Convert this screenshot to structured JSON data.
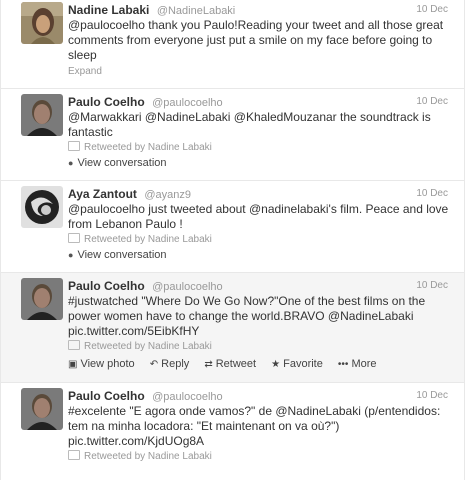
{
  "tweets": [
    {
      "name": "Nadine Labaki",
      "handle": "@NadineLabaki",
      "date": "10 Dec",
      "text": "@paulocoelho thank you Paulo!Reading your tweet and all those great comments from everyone just put a smile on my face before going to sleep",
      "expand": "Expand"
    },
    {
      "name": "Paulo Coelho",
      "handle": "@paulocoelho",
      "date": "10 Dec",
      "text": "@Marwakkari @NadineLabaki @KhaledMouzanar the soundtrack is fantastic",
      "retweeted": "Retweeted by Nadine Labaki",
      "view_conversation": "View conversation"
    },
    {
      "name": "Aya Zantout",
      "handle": "@ayanz9",
      "date": "10 Dec",
      "text": "@paulocoelho just tweeted about @nadinelabaki's film. Peace and love from Lebanon Paulo !",
      "retweeted": "Retweeted by Nadine Labaki",
      "view_conversation": "View conversation"
    },
    {
      "name": "Paulo Coelho",
      "handle": "@paulocoelho",
      "date": "10 Dec",
      "text": "#justwatched \"Where Do We Go Now?\"One of the best films on the power women have to change the world.BRAVO @NadineLabaki pic.twitter.com/5EibKfHY",
      "retweeted": "Retweeted by Nadine Labaki",
      "actions": {
        "view_photo": "View photo",
        "reply": "Reply",
        "retweet": "Retweet",
        "favorite": "Favorite",
        "more": "More"
      }
    },
    {
      "name": "Paulo Coelho",
      "handle": "@paulocoelho",
      "date": "10 Dec",
      "text": "#excelente \"E agora onde vamos?\" de @NadineLabaki (p/entendidos: tem na minha locadora: \"Et maintenant on va où?\") pic.twitter.com/KjdUOg8A",
      "retweeted": "Retweeted by Nadine Labaki"
    }
  ],
  "icons": {
    "retweet": "rt-icon",
    "conversation": "speech-bubble-icon",
    "photo": "photo-icon",
    "reply": "reply-arrow-icon",
    "favorite": "star-icon",
    "more": "ellipsis-icon"
  }
}
